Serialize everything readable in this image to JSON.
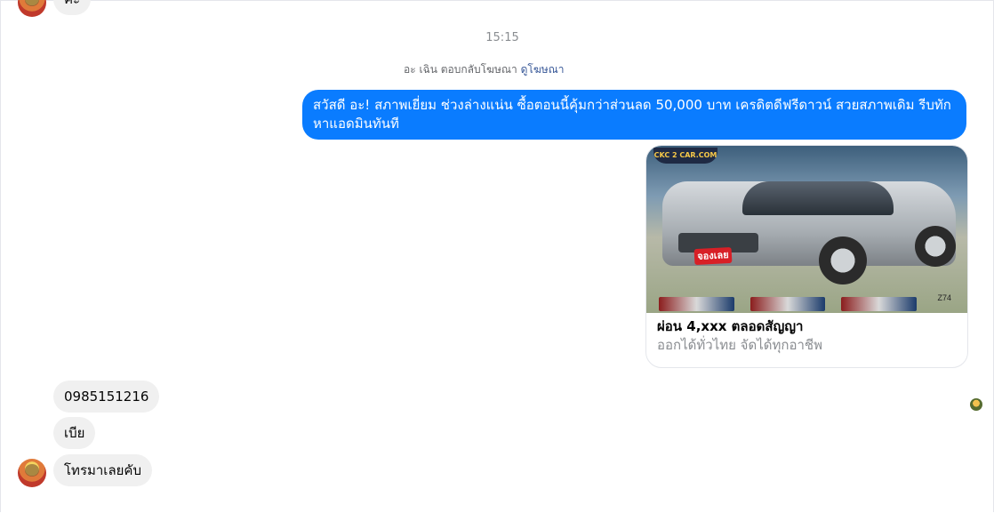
{
  "conversation": {
    "top_message": "ค่ะ",
    "timestamp": "15:15",
    "reply_note": {
      "text": "อะ เฉิน ตอบกลับโฆษณา",
      "link": "ดูโฆษณา"
    },
    "outgoing_message": "สวัสดี อะ!  สภาพเยี่ยม ช่วงล่างแน่น  ซื้อตอนนี้คุ้มกว่าส่วนลด 50,000 บาท เครดิตดีฟรีดาวน์  สวยสภาพเดิม รีบทักหาแอดมินทันที",
    "ad_card": {
      "image_label": "CKC 2 CAR.COM",
      "sticker_text": "จองเลย",
      "image_code": "Z74",
      "title": "ผ่อน 4,xxx ตลอดสัญญา",
      "subtitle": "ออกได้ทั่วไทย จัดได้ทุกอาชีพ"
    },
    "incoming_messages": [
      "0985151216",
      "เบีย",
      "โทรมาเลยคับ"
    ]
  },
  "colors": {
    "outgoing_bubble": "#0a7cff",
    "incoming_bubble": "#f0f0f0",
    "link": "#385898"
  },
  "icons": {
    "sender_avatar": "profile-photo",
    "seen_indicator": "seen-avatar"
  }
}
